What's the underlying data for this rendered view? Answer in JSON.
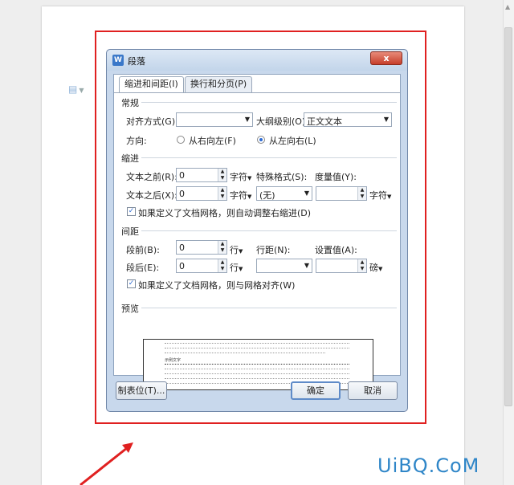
{
  "dialog": {
    "title": "段落",
    "app_icon": "W",
    "close_label": "x"
  },
  "tabs": [
    {
      "label": "缩进和间距(I)"
    },
    {
      "label": "换行和分页(P)"
    }
  ],
  "general": {
    "header": "常规",
    "alignment_label": "对齐方式(G):",
    "alignment_value": "",
    "outline_label": "大纲级别(O):",
    "outline_value": "正文文本",
    "direction_label": "方向:",
    "rtl_label": "从右向左(F)",
    "ltr_label": "从左向右(L)"
  },
  "indent": {
    "header": "缩进",
    "before_label": "文本之前(R):",
    "before_value": "0",
    "before_unit": "字符",
    "special_label": "特殊格式(S):",
    "special_value": "(无)",
    "measure_label": "度量值(Y):",
    "measure_value": "",
    "measure_unit": "字符",
    "after_label": "文本之后(X):",
    "after_value": "0",
    "after_unit": "字符",
    "grid_check_label": "如果定义了文档网格，则自动调整右缩进(D)"
  },
  "spacing": {
    "header": "间距",
    "before_label": "段前(B):",
    "before_value": "0",
    "before_unit": "行",
    "line_label": "行距(N):",
    "line_value": "",
    "setting_label": "设置值(A):",
    "setting_value": "",
    "setting_unit": "磅",
    "after_label": "段后(E):",
    "after_value": "0",
    "after_unit": "行",
    "grid_check_label": "如果定义了文档网格，则与网格对齐(W)"
  },
  "preview": {
    "header": "预览",
    "sample_text": "示例文字"
  },
  "buttons": {
    "tabs_label": "制表位(T)...",
    "ok_label": "确定",
    "cancel_label": "取消"
  },
  "watermark": "UiBQ.CoM",
  "colors": {
    "highlight_frame": "#e02020",
    "dialog_bg": "#c8d8ec",
    "watermark": "#2f86c8"
  }
}
